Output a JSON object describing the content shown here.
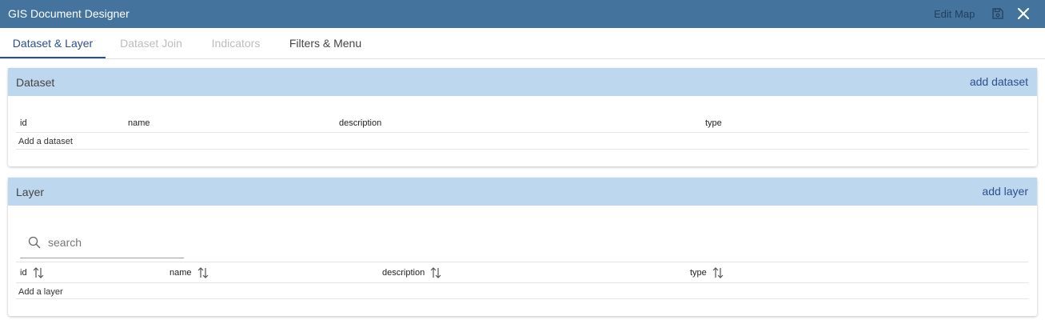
{
  "app": {
    "title": "GIS Document Designer",
    "edit_map_label": "Edit Map"
  },
  "tabs": [
    {
      "label": "Dataset & Layer",
      "state": "active"
    },
    {
      "label": "Dataset Join",
      "state": "disabled"
    },
    {
      "label": "Indicators",
      "state": "disabled"
    },
    {
      "label": "Filters & Menu",
      "state": "normal"
    }
  ],
  "dataset": {
    "title": "Dataset",
    "add_label": "add dataset",
    "columns": [
      "id",
      "name",
      "description",
      "type"
    ],
    "empty_text": "Add a dataset"
  },
  "layer": {
    "title": "Layer",
    "add_label": "add layer",
    "search_placeholder": "search",
    "columns": [
      "id",
      "name",
      "description",
      "type"
    ],
    "empty_text": "Add a layer"
  },
  "icons": {
    "save": "save-icon",
    "close": "close-icon",
    "search": "search-icon",
    "sort": "sort-arrows-icon"
  },
  "colors": {
    "titlebar": "#44739e",
    "panel_header": "#bdd7ee",
    "accent": "#2c4f8f"
  }
}
